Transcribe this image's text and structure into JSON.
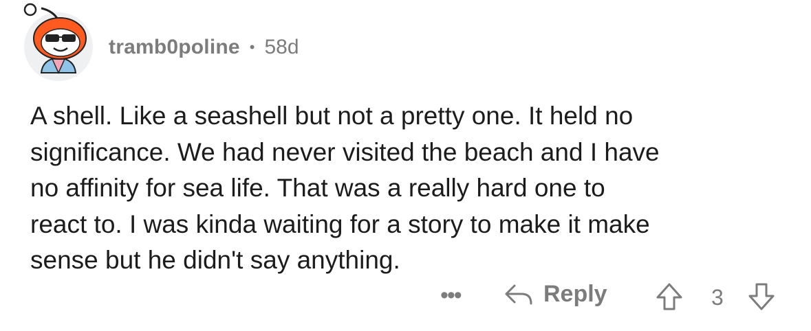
{
  "comment": {
    "username": "tramb0poline",
    "separator": "•",
    "age": "58d",
    "body_lines": [
      "A shell. Like a seashell but not a pretty one. It held no",
      "significance. We had never visited the beach and I have",
      "no affinity for sea life. That was a really hard one to",
      "react to. I was kinda waiting for a story to make it make",
      "sense but he didn't say anything."
    ]
  },
  "actions": {
    "more_label": "•••",
    "reply_label": "Reply",
    "score": "3"
  },
  "icons": {
    "avatar": "snoo-avatar-icon",
    "more": "more-options-icon",
    "reply": "reply-arrow-icon",
    "upvote": "upvote-arrow-icon",
    "downvote": "downvote-arrow-icon"
  },
  "colors": {
    "meta_text": "#7c7c7c",
    "body_text": "#1c1c1c",
    "avatar_orange": "#ff4500"
  }
}
